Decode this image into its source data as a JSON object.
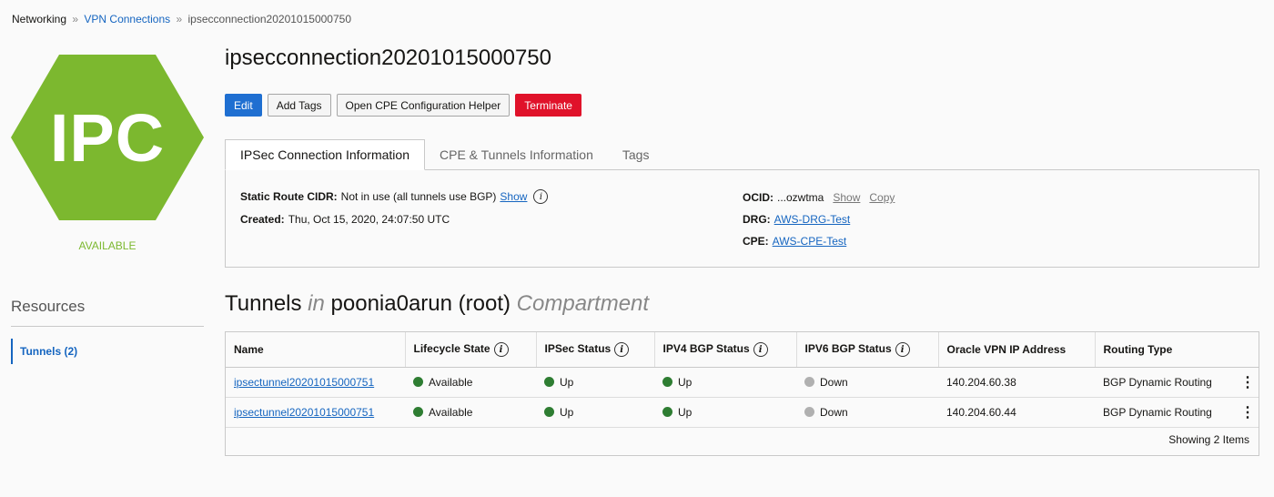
{
  "breadcrumb": {
    "root": "Networking",
    "sep": "»",
    "parent": "VPN Connections",
    "current": "ipsecconnection20201015000750"
  },
  "resource": {
    "badge_text": "IPC",
    "badge_color": "#7cb82f",
    "state": "AVAILABLE"
  },
  "sidebar": {
    "title": "Resources",
    "items": [
      {
        "label": "Tunnels (2)"
      }
    ]
  },
  "page": {
    "title": "ipsecconnection20201015000750"
  },
  "actions": {
    "edit": "Edit",
    "add_tags": "Add Tags",
    "cpe_helper": "Open CPE Configuration Helper",
    "terminate": "Terminate"
  },
  "tabs": [
    {
      "label": "IPSec Connection Information"
    },
    {
      "label": "CPE & Tunnels Information"
    },
    {
      "label": "Tags"
    }
  ],
  "info": {
    "static_route_label": "Static Route CIDR:",
    "static_route_value": "Not in use (all tunnels use BGP)",
    "static_route_show": "Show",
    "created_label": "Created:",
    "created_value": "Thu, Oct 15, 2020, 24:07:50 UTC",
    "ocid_label": "OCID:",
    "ocid_value": "...ozwtma",
    "ocid_show": "Show",
    "ocid_copy": "Copy",
    "drg_label": "DRG:",
    "drg_value": "AWS-DRG-Test",
    "cpe_label": "CPE:",
    "cpe_value": "AWS-CPE-Test"
  },
  "tunnels": {
    "title_main": "Tunnels",
    "title_in": "in",
    "title_comp": "poonia0arun (root)",
    "title_suffix": "Compartment",
    "columns": [
      "Name",
      "Lifecycle State",
      "IPSec Status",
      "IPV4 BGP Status",
      "IPV6 BGP Status",
      "Oracle VPN IP Address",
      "Routing Type"
    ],
    "rows": [
      {
        "name": "ipsectunnel20201015000751",
        "lifecycle": "Available",
        "ipsec": "Up",
        "ipv4": "Up",
        "ipv6": "Down",
        "ip": "140.204.60.38",
        "routing": "BGP Dynamic Routing"
      },
      {
        "name": "ipsectunnel20201015000751",
        "lifecycle": "Available",
        "ipsec": "Up",
        "ipv4": "Up",
        "ipv6": "Down",
        "ip": "140.204.60.44",
        "routing": "BGP Dynamic Routing"
      }
    ],
    "footer": "Showing 2 Items",
    "colors": {
      "available": "#2e7d32",
      "up": "#2e7d32",
      "down": "#b0b0b0"
    },
    "info_glyph": "i",
    "menu_glyph": "⋮"
  }
}
